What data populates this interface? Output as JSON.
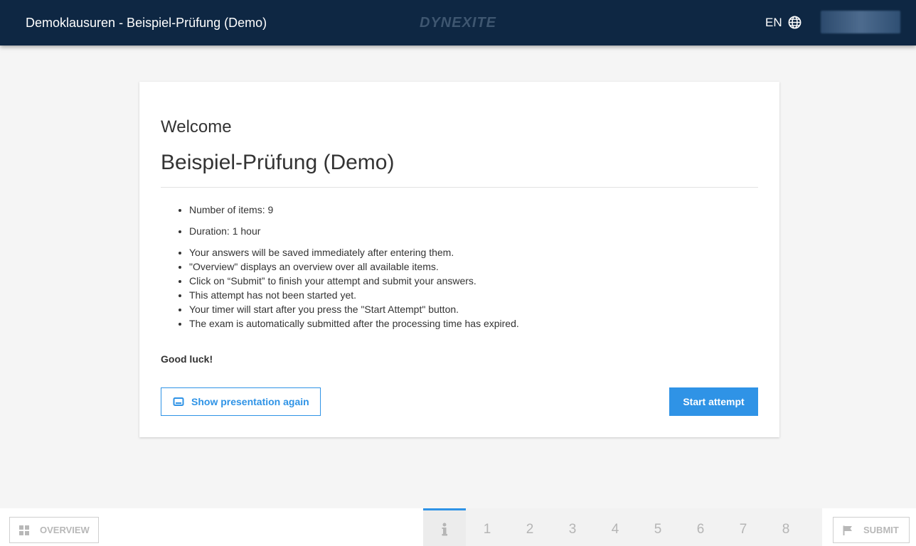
{
  "header": {
    "title": "Demoklausuren - Beispiel-Prüfung (Demo)",
    "logo_text": "DYNEXITE",
    "language": "EN",
    "globe_icon": "globe-icon"
  },
  "card": {
    "welcome": "Welcome",
    "exam_title": "Beispiel-Prüfung (Demo)",
    "info_group_1": [
      "Number of items: 9"
    ],
    "info_group_2": [
      "Duration: 1 hour"
    ],
    "info_group_3": [
      "Your answers will be saved immediately after entering them.",
      "\"Overview\" displays an overview over all available items.",
      "Click on “Submit” to finish your attempt and submit your answers.",
      "This attempt has not been started yet.",
      "Your timer will start after you press the \"Start Attempt\" button.",
      "The exam is automatically submitted after the processing time has expired."
    ],
    "good_luck": "Good luck!",
    "show_presentation_label": "Show presentation again",
    "start_attempt_label": "Start attempt"
  },
  "footer": {
    "overview_label": "OVERVIEW",
    "submit_label": "SUBMIT",
    "pages": [
      "1",
      "2",
      "3",
      "4",
      "5",
      "6",
      "7",
      "8"
    ],
    "active_page": "info"
  },
  "colors": {
    "header_bg": "#0e2743",
    "accent": "#2f93e6",
    "page_bg": "#f5f5f5"
  }
}
